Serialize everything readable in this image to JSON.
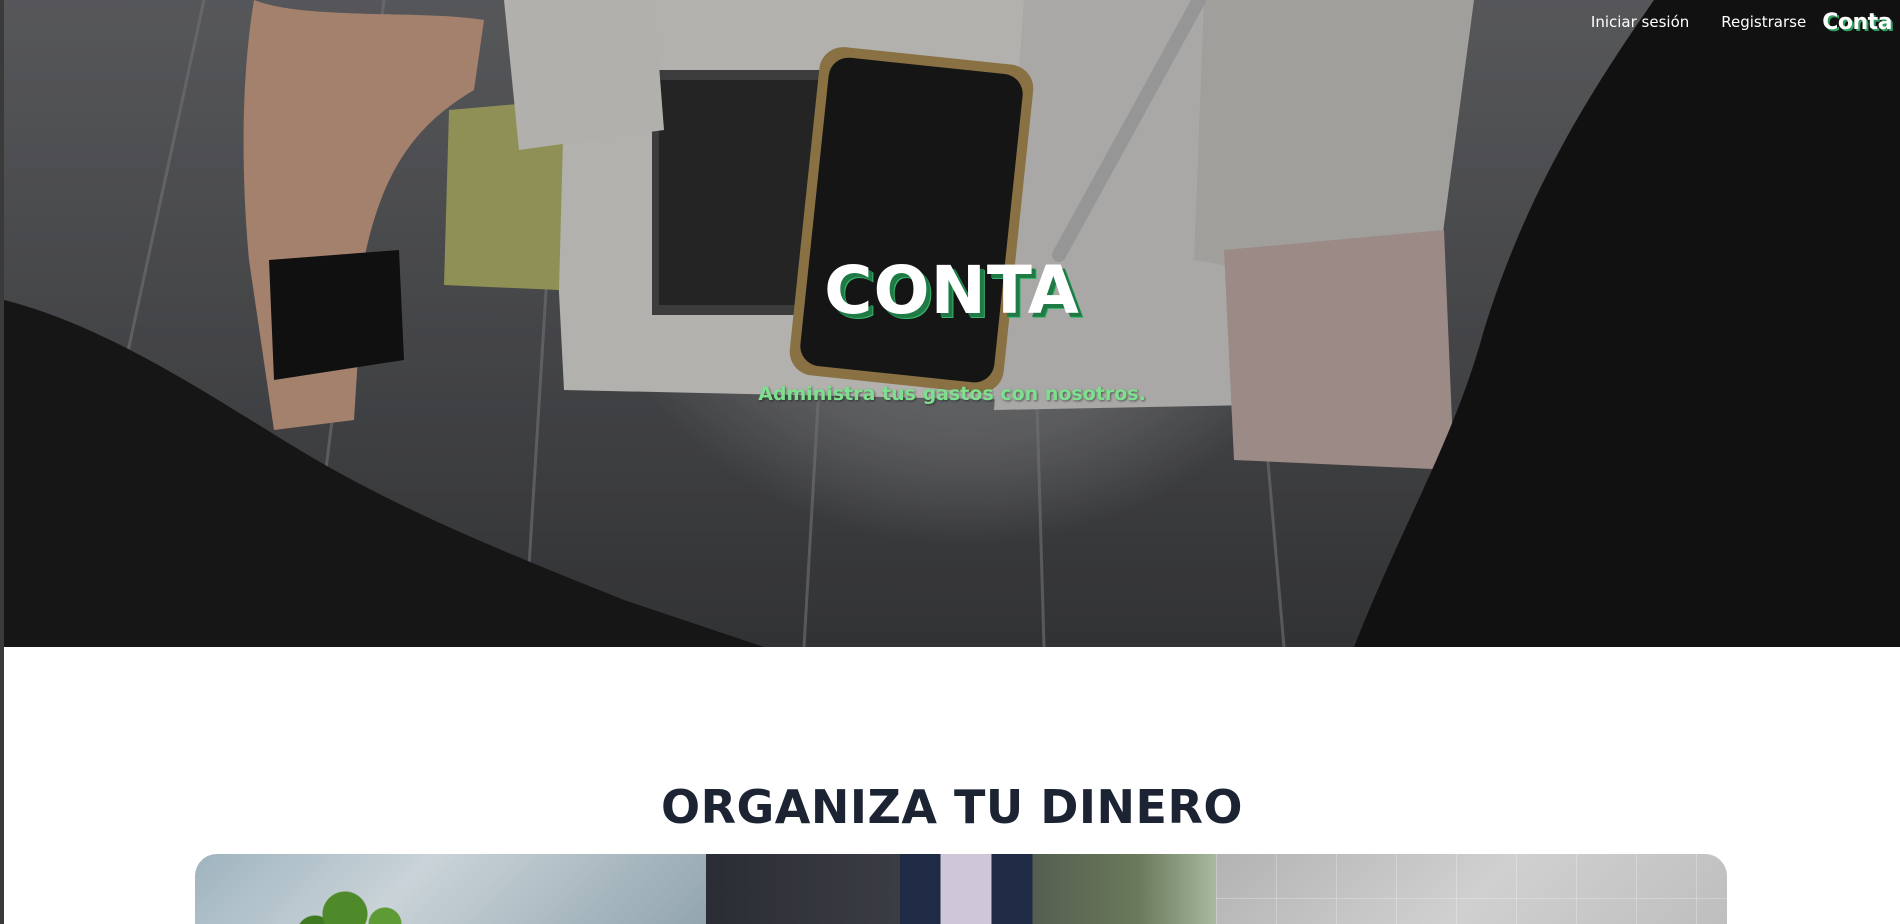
{
  "nav": {
    "login": "Iniciar sesión",
    "register": "Registrarse",
    "brand": "Conta"
  },
  "hero": {
    "title": "CONTA",
    "subtitle": "Administra tus gastos con nosotros."
  },
  "section": {
    "title": "ORGANIZA TU DINERO"
  },
  "colors": {
    "accent_green": "#7ee08f",
    "title_shadow_green": "#37b36b",
    "heading_dark": "#1c2333"
  }
}
